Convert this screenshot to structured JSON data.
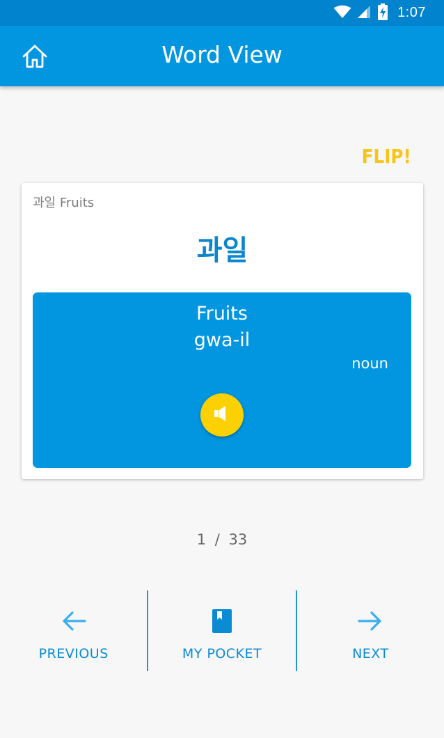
{
  "status_bar": {
    "time": "1:07",
    "icons": [
      "wifi-icon",
      "signal-icon",
      "battery-charging-icon"
    ]
  },
  "app_bar": {
    "title": "Word View",
    "home_icon": "home-icon"
  },
  "flip_label": "FLIP!",
  "card": {
    "caption": "과일 Fruits",
    "word": "과일",
    "meaning": "Fruits",
    "romanization": "gwa-il",
    "part_of_speech": "noun",
    "sound_icon": "speaker-icon"
  },
  "pagination": {
    "current": "1",
    "separator": "/",
    "total": "33"
  },
  "bottom_nav": {
    "previous_label": "PREVIOUS",
    "pocket_label": "MY POCKET",
    "next_label": "NEXT"
  },
  "colors": {
    "primary": "#0296e0",
    "status_bar": "#0283cd",
    "accent_yellow": "#fbd103",
    "flip": "#f7c51a",
    "link_blue": "#0a8bd3"
  }
}
